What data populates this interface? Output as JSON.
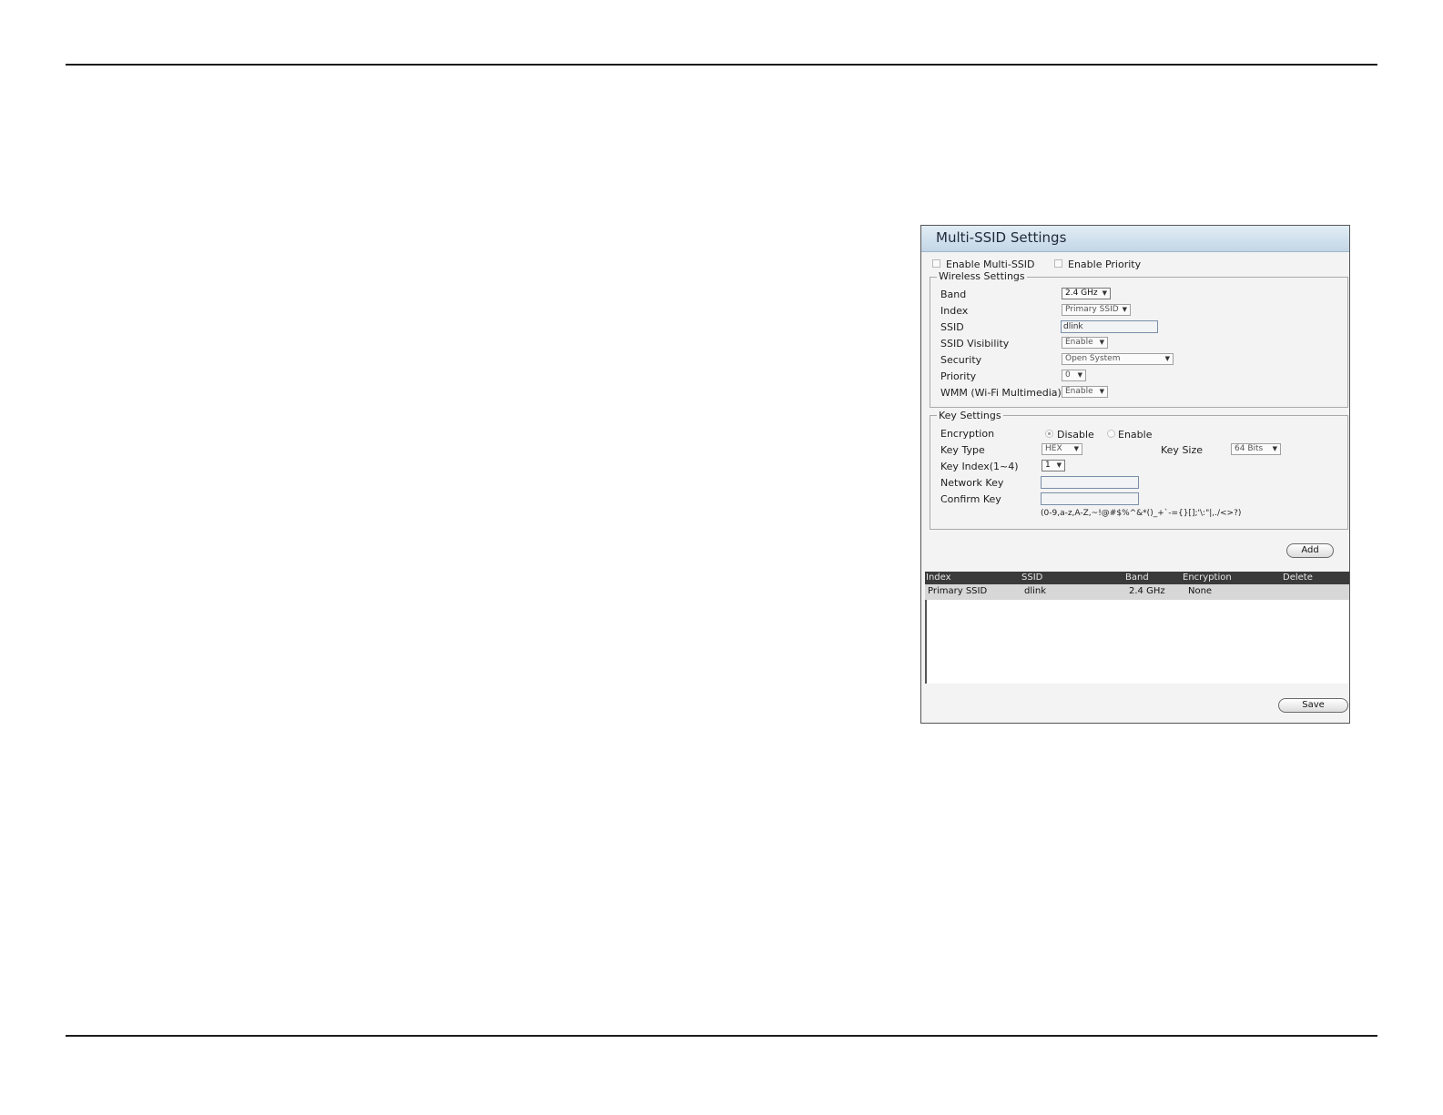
{
  "panel": {
    "title": "Multi-SSID Settings"
  },
  "top_options": {
    "enable_multi_ssid": "Enable Multi-SSID",
    "enable_priority": "Enable Priority"
  },
  "wireless_settings": {
    "legend": "Wireless Settings",
    "band_label": "Band",
    "band_value": "2.4 GHz",
    "index_label": "Index",
    "index_value": "Primary SSID",
    "ssid_label": "SSID",
    "ssid_value": "dlink",
    "visibility_label": "SSID Visibility",
    "visibility_value": "Enable",
    "security_label": "Security",
    "security_value": "Open System",
    "priority_label": "Priority",
    "priority_value": "0",
    "wmm_label": "WMM (Wi-Fi Multimedia)",
    "wmm_value": "Enable"
  },
  "key_settings": {
    "legend": "Key Settings",
    "encryption_label": "Encryption",
    "disable_label": "Disable",
    "enable_label": "Enable",
    "key_type_label": "Key Type",
    "key_type_value": "HEX",
    "key_size_label": "Key Size",
    "key_size_value": "64 Bits",
    "key_index_label": "Key Index(1~4)",
    "key_index_value": "1",
    "network_key_label": "Network Key",
    "network_key_value": "",
    "confirm_key_label": "Confirm Key",
    "confirm_key_value": "",
    "allowed_chars": "(0-9,a-z,A-Z,~!@#$%^&*()_+`-={}[];'\\:\"|,./<>?)"
  },
  "buttons": {
    "add": "Add",
    "save": "Save"
  },
  "table": {
    "headers": [
      "Index",
      "SSID",
      "Band",
      "Encryption",
      "Delete"
    ],
    "rows": [
      {
        "index": "Primary SSID",
        "ssid": "dlink",
        "band": "2.4 GHz",
        "encryption": "None",
        "delete": ""
      }
    ]
  },
  "arrow_glyph": "▼"
}
